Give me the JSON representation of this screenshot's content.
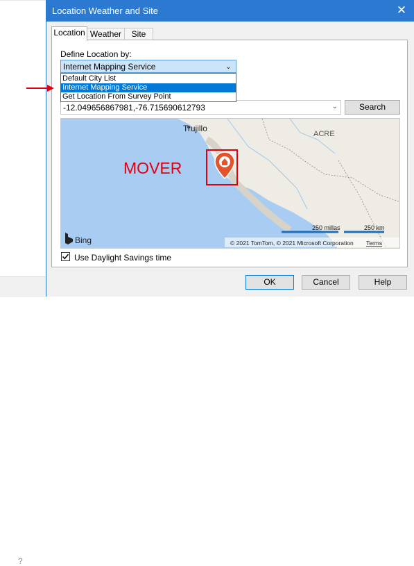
{
  "background": {
    "help_glyph": "?"
  },
  "dialog": {
    "title": "Location Weather and Site",
    "close_glyph": "✕",
    "tabs": [
      {
        "label": "Location",
        "active": true
      },
      {
        "label": "Weather",
        "active": false
      },
      {
        "label": "Site",
        "active": false
      }
    ],
    "define_label": "Define Location by:",
    "define_selected": "Internet Mapping Service",
    "dropdown_options": [
      "Default City List",
      "Internet Mapping Service",
      "Get Location From Survey Point"
    ],
    "dropdown_selected_index": 1,
    "coordinates_value": "-12.049656867981,-76.715690612793",
    "search_button": "Search",
    "map": {
      "city_label": "Trujillo",
      "region_label": "ACRE",
      "annotation": "MOVER",
      "brand": "Bing",
      "scale_miles": "250 millas",
      "scale_km": "250 km",
      "copyright": "© 2021 TomTom, © 2021 Microsoft Corporation",
      "terms_link": "Terms"
    },
    "daylight_label": "Use Daylight Savings time",
    "daylight_checked": true,
    "ok_button": "OK",
    "cancel_button": "Cancel",
    "help_button": "Help"
  },
  "colors": {
    "titlebar": "#2b79d0",
    "selection": "#0078d7",
    "annotation_red": "#e0000f",
    "sea": "#a8ccf2",
    "land": "#efece5"
  }
}
